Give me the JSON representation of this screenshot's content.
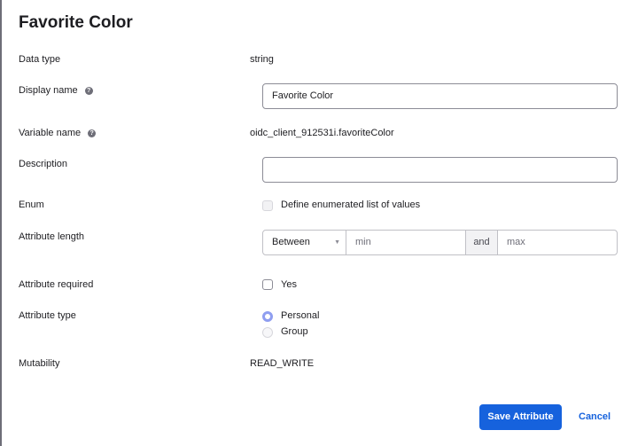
{
  "title": "Favorite Color",
  "rows": {
    "data_type": {
      "label": "Data type",
      "value": "string"
    },
    "display_name": {
      "label": "Display name",
      "value": "Favorite Color"
    },
    "variable_name": {
      "label": "Variable name",
      "value": "oidc_client_912531i.favoriteColor"
    },
    "description": {
      "label": "Description",
      "value": ""
    },
    "enum": {
      "label": "Enum",
      "option": "Define enumerated list of values"
    },
    "attribute_length": {
      "label": "Attribute length",
      "select": "Between",
      "min_placeholder": "min",
      "and": "and",
      "max_placeholder": "max"
    },
    "attribute_required": {
      "label": "Attribute required",
      "option": "Yes"
    },
    "attribute_type": {
      "label": "Attribute type",
      "options": [
        "Personal",
        "Group"
      ]
    },
    "mutability": {
      "label": "Mutability",
      "value": "READ_WRITE"
    }
  },
  "help_glyph": "?",
  "buttons": {
    "save": "Save Attribute",
    "cancel": "Cancel"
  }
}
